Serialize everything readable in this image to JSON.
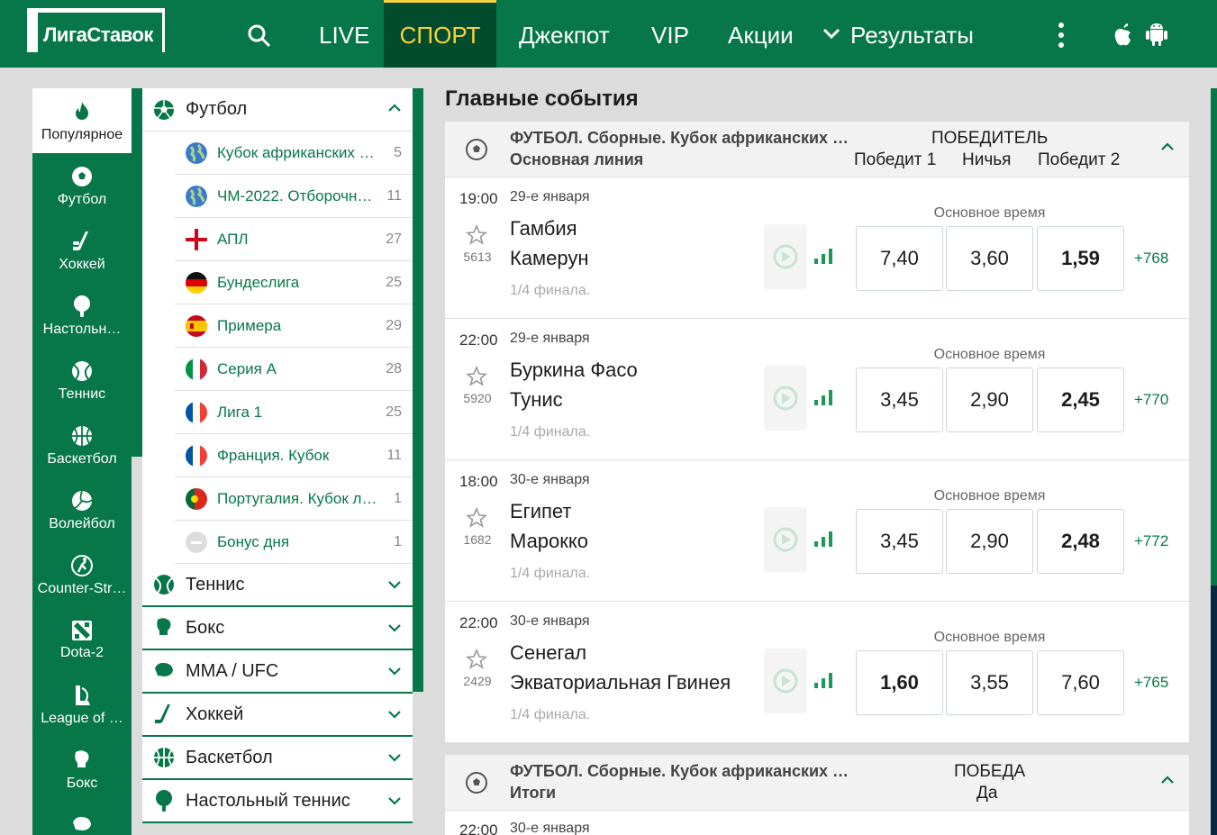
{
  "header": {
    "logo_text": "ЛигаСтавок",
    "nav": [
      "LIVE",
      "СПОРТ",
      "Джекпот",
      "VIP",
      "Акции",
      "Результаты"
    ],
    "active_nav": "СПОРТ"
  },
  "icon_sidebar": {
    "items": [
      {
        "label": "Популярное",
        "icon": "flame-icon"
      },
      {
        "label": "Футбол",
        "icon": "soccer-ball-icon"
      },
      {
        "label": "Хоккей",
        "icon": "hockey-stick-icon"
      },
      {
        "label": "Настольн…",
        "icon": "table-tennis-icon"
      },
      {
        "label": "Теннис",
        "icon": "tennis-ball-icon"
      },
      {
        "label": "Баскетбол",
        "icon": "basketball-icon"
      },
      {
        "label": "Волейбол",
        "icon": "volleyball-icon"
      },
      {
        "label": "Counter-Str…",
        "icon": "counter-strike-icon"
      },
      {
        "label": "Dota-2",
        "icon": "dota-icon"
      },
      {
        "label": "League of …",
        "icon": "league-of-legends-icon"
      },
      {
        "label": "Бокс",
        "icon": "boxing-glove-icon"
      }
    ]
  },
  "sports_menu": {
    "open_sport": "Футбол",
    "tournaments": [
      {
        "label": "Кубок африканских н…",
        "count": "5",
        "flag": "globe"
      },
      {
        "label": "ЧМ-2022. Отборочны…",
        "count": "11",
        "flag": "globe"
      },
      {
        "label": "АПЛ",
        "count": "27",
        "flag": "england"
      },
      {
        "label": "Бундеслига",
        "count": "25",
        "flag": "germany"
      },
      {
        "label": "Примера",
        "count": "29",
        "flag": "spain"
      },
      {
        "label": "Серия А",
        "count": "28",
        "flag": "italy"
      },
      {
        "label": "Лига 1",
        "count": "25",
        "flag": "france"
      },
      {
        "label": "Франция. Кубок",
        "count": "11",
        "flag": "france"
      },
      {
        "label": "Португалия. Кубок лиги",
        "count": "1",
        "flag": "portugal"
      },
      {
        "label": "Бонус дня",
        "count": "1",
        "flag": "bonus"
      }
    ],
    "closed_sports": [
      "Теннис",
      "Бокс",
      "MMA / UFC",
      "Хоккей",
      "Баскетбол",
      "Настольный теннис"
    ]
  },
  "main": {
    "title": "Главные события",
    "group1": {
      "title": "ФУТБОЛ. Сборные. Кубок африканских …",
      "subtitle": "Основная линия",
      "market": "ПОБЕДИТЕЛЬ",
      "cols": [
        "Победит 1",
        "Ничья",
        "Победит 2"
      ]
    },
    "matches": [
      {
        "time": "19:00",
        "date": "29-е января",
        "fav": "5613",
        "team1": "Гамбия",
        "team2": "Камерун",
        "stage": "1/4 финала.",
        "period": "Основное время",
        "odds": [
          "7,40",
          "3,60",
          "1,59"
        ],
        "best": 2,
        "more": "+768"
      },
      {
        "time": "22:00",
        "date": "29-е января",
        "fav": "5920",
        "team1": "Буркина Фасо",
        "team2": "Тунис",
        "stage": "1/4 финала.",
        "period": "Основное время",
        "odds": [
          "3,45",
          "2,90",
          "2,45"
        ],
        "best": 2,
        "more": "+770"
      },
      {
        "time": "18:00",
        "date": "30-е января",
        "fav": "1682",
        "team1": "Египет",
        "team2": "Марокко",
        "stage": "1/4 финала.",
        "period": "Основное время",
        "odds": [
          "3,45",
          "2,90",
          "2,48"
        ],
        "best": 2,
        "more": "+772"
      },
      {
        "time": "22:00",
        "date": "30-е января",
        "fav": "2429",
        "team1": "Сенегал",
        "team2": "Экваториальная Гвинея",
        "stage": "1/4 финала.",
        "period": "Основное время",
        "odds": [
          "1,60",
          "3,55",
          "7,60"
        ],
        "best": 0,
        "more": "+765"
      }
    ],
    "group2": {
      "title": "ФУТБОЛ. Сборные. Кубок африканских …",
      "subtitle": "Итоги",
      "market": "ПОБЕДА",
      "col": "Да",
      "next_time": "22:00",
      "next_date": "30-е января"
    }
  },
  "colors": {
    "brand_green": "#07774a",
    "dark_green": "#034b2d",
    "accent_yellow": "#f5d43a"
  }
}
